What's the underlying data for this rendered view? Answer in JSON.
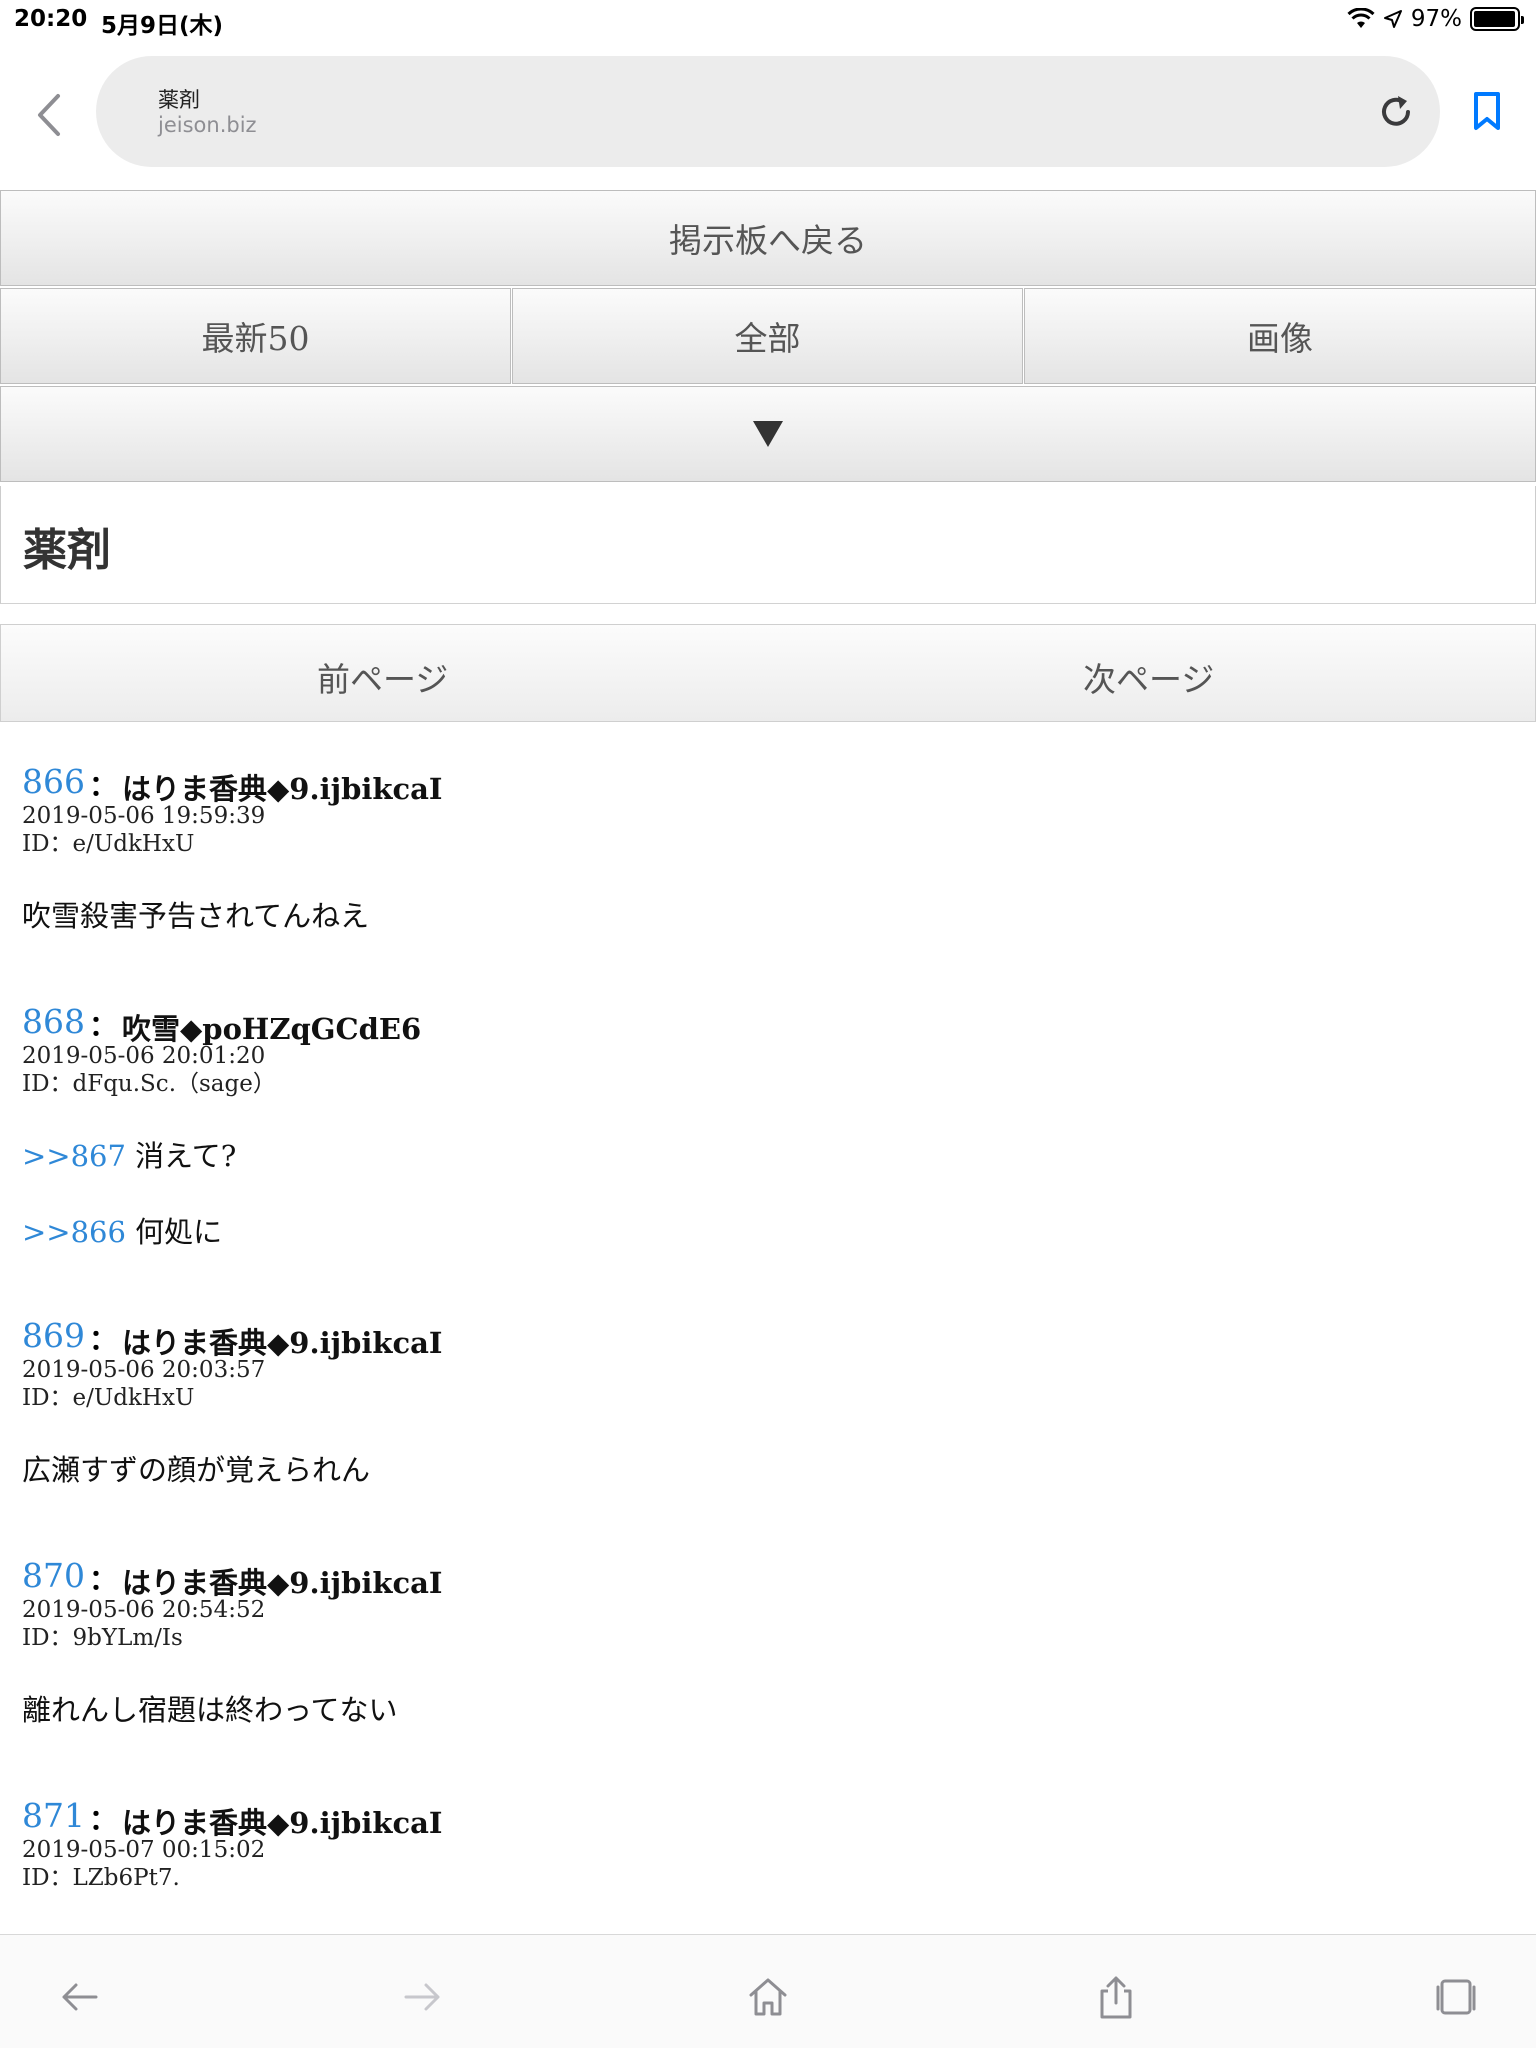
{
  "status_bar": {
    "time": "20:20",
    "date": "5月9日(木)",
    "battery_text": "97%",
    "battery_level": 0.97
  },
  "browser": {
    "page_title": "薬剤",
    "domain": "jeison.biz",
    "accent_color": "#007aff"
  },
  "nav": {
    "back_to_board": "掲示板へ戻る",
    "latest": "最新50",
    "all": "全部",
    "images": "画像",
    "more_symbol": "▼"
  },
  "thread": {
    "title": "薬剤"
  },
  "pager": {
    "prev": "前ページ",
    "next": "次ページ"
  },
  "posts": [
    {
      "number": "866",
      "colon": "：",
      "name": "はりま香典◆9.ijbikcaI",
      "date": "2019-05-06 19:59:39",
      "id": "ID：e/UdkHxU",
      "lines": [
        {
          "anchor": "",
          "text": "吹雪殺害予告されてんねえ"
        }
      ]
    },
    {
      "number": "868",
      "colon": "：",
      "name": "吹雪◆poHZqGCdE6",
      "date": "2019-05-06 20:01:20",
      "id": "ID：dFqu.Sc.（sage）",
      "lines": [
        {
          "anchor": ">>867",
          "text": " 消えて?"
        },
        {
          "anchor": ">>866",
          "text": " 何処に"
        }
      ]
    },
    {
      "number": "869",
      "colon": "：",
      "name": "はりま香典◆9.ijbikcaI",
      "date": "2019-05-06 20:03:57",
      "id": "ID：e/UdkHxU",
      "lines": [
        {
          "anchor": "",
          "text": "広瀬すずの顔が覚えられん"
        }
      ]
    },
    {
      "number": "870",
      "colon": "：",
      "name": "はりま香典◆9.ijbikcaI",
      "date": "2019-05-06 20:54:52",
      "id": "ID：9bYLm/Is",
      "lines": [
        {
          "anchor": "",
          "text": "離れんし宿題は終わってない"
        }
      ]
    },
    {
      "number": "871",
      "colon": "：",
      "name": "はりま香典◆9.ijbikcaI",
      "date": "2019-05-07 00:15:02",
      "id": "ID：LZb6Pt7.",
      "lines": []
    }
  ],
  "toolbar": {
    "icons": [
      "back-arrow-icon",
      "forward-arrow-icon",
      "home-icon",
      "share-icon",
      "tabs-icon"
    ]
  }
}
